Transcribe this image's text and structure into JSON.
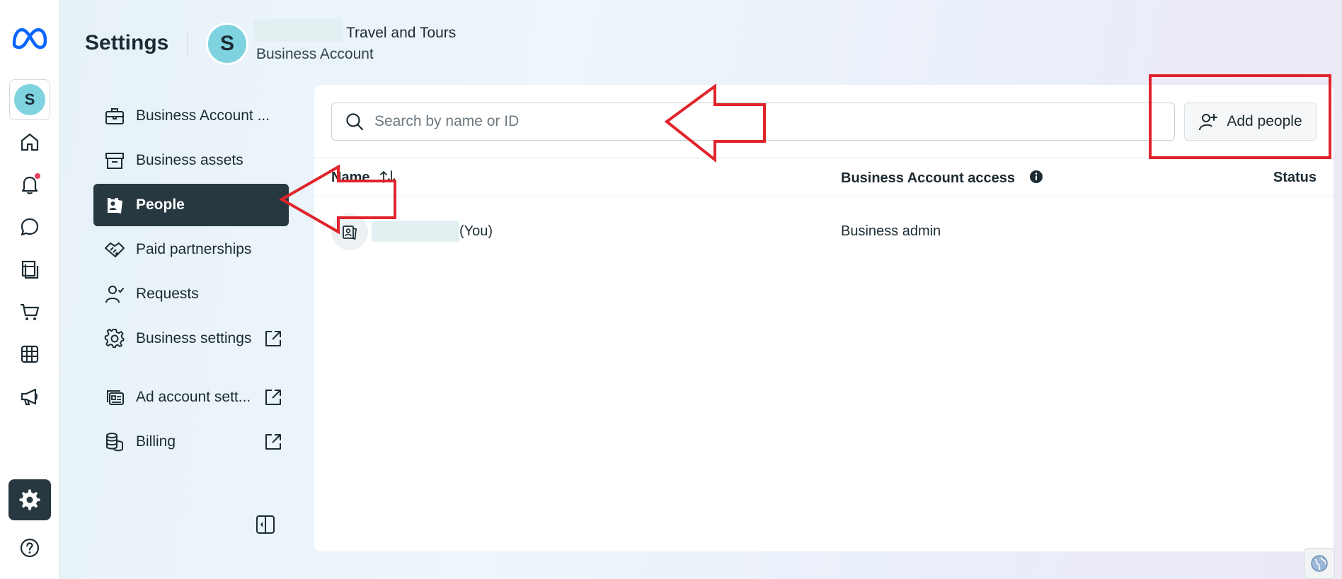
{
  "header": {
    "title": "Settings",
    "avatar_letter": "S",
    "business_name": "Travel and Tours",
    "business_type": "Business Account"
  },
  "rail": {
    "account_letter": "S",
    "icons": [
      "meta-logo-icon",
      "home-icon",
      "bell-icon",
      "chat-icon",
      "pages-icon",
      "cart-icon",
      "table-icon",
      "megaphone-icon",
      "gear-icon",
      "help-icon"
    ]
  },
  "nav": {
    "items": [
      {
        "label": "Business Account ...",
        "icon": "briefcase-icon"
      },
      {
        "label": "Business assets",
        "icon": "archive-box-icon"
      },
      {
        "label": "People",
        "icon": "people-badge-icon",
        "active": true
      },
      {
        "label": "Paid partnerships",
        "icon": "handshake-icon"
      },
      {
        "label": "Requests",
        "icon": "person-check-icon"
      },
      {
        "label": "Business settings",
        "icon": "gear-icon",
        "external": true
      },
      {
        "label": "Ad account sett...",
        "icon": "ad-account-icon",
        "external": true
      },
      {
        "label": "Billing",
        "icon": "coins-icon",
        "external": true
      }
    ]
  },
  "main": {
    "search_placeholder": "Search by name or ID",
    "add_button_label": "Add people",
    "columns": {
      "name": "Name",
      "access": "Business Account access",
      "status": "Status"
    },
    "rows": [
      {
        "you_label": "(You)",
        "access": "Business admin",
        "status": ""
      }
    ]
  },
  "colors": {
    "accent_dark": "#283840",
    "annotation_red": "#e0242c",
    "avatar_teal": "#7fd3e0"
  }
}
